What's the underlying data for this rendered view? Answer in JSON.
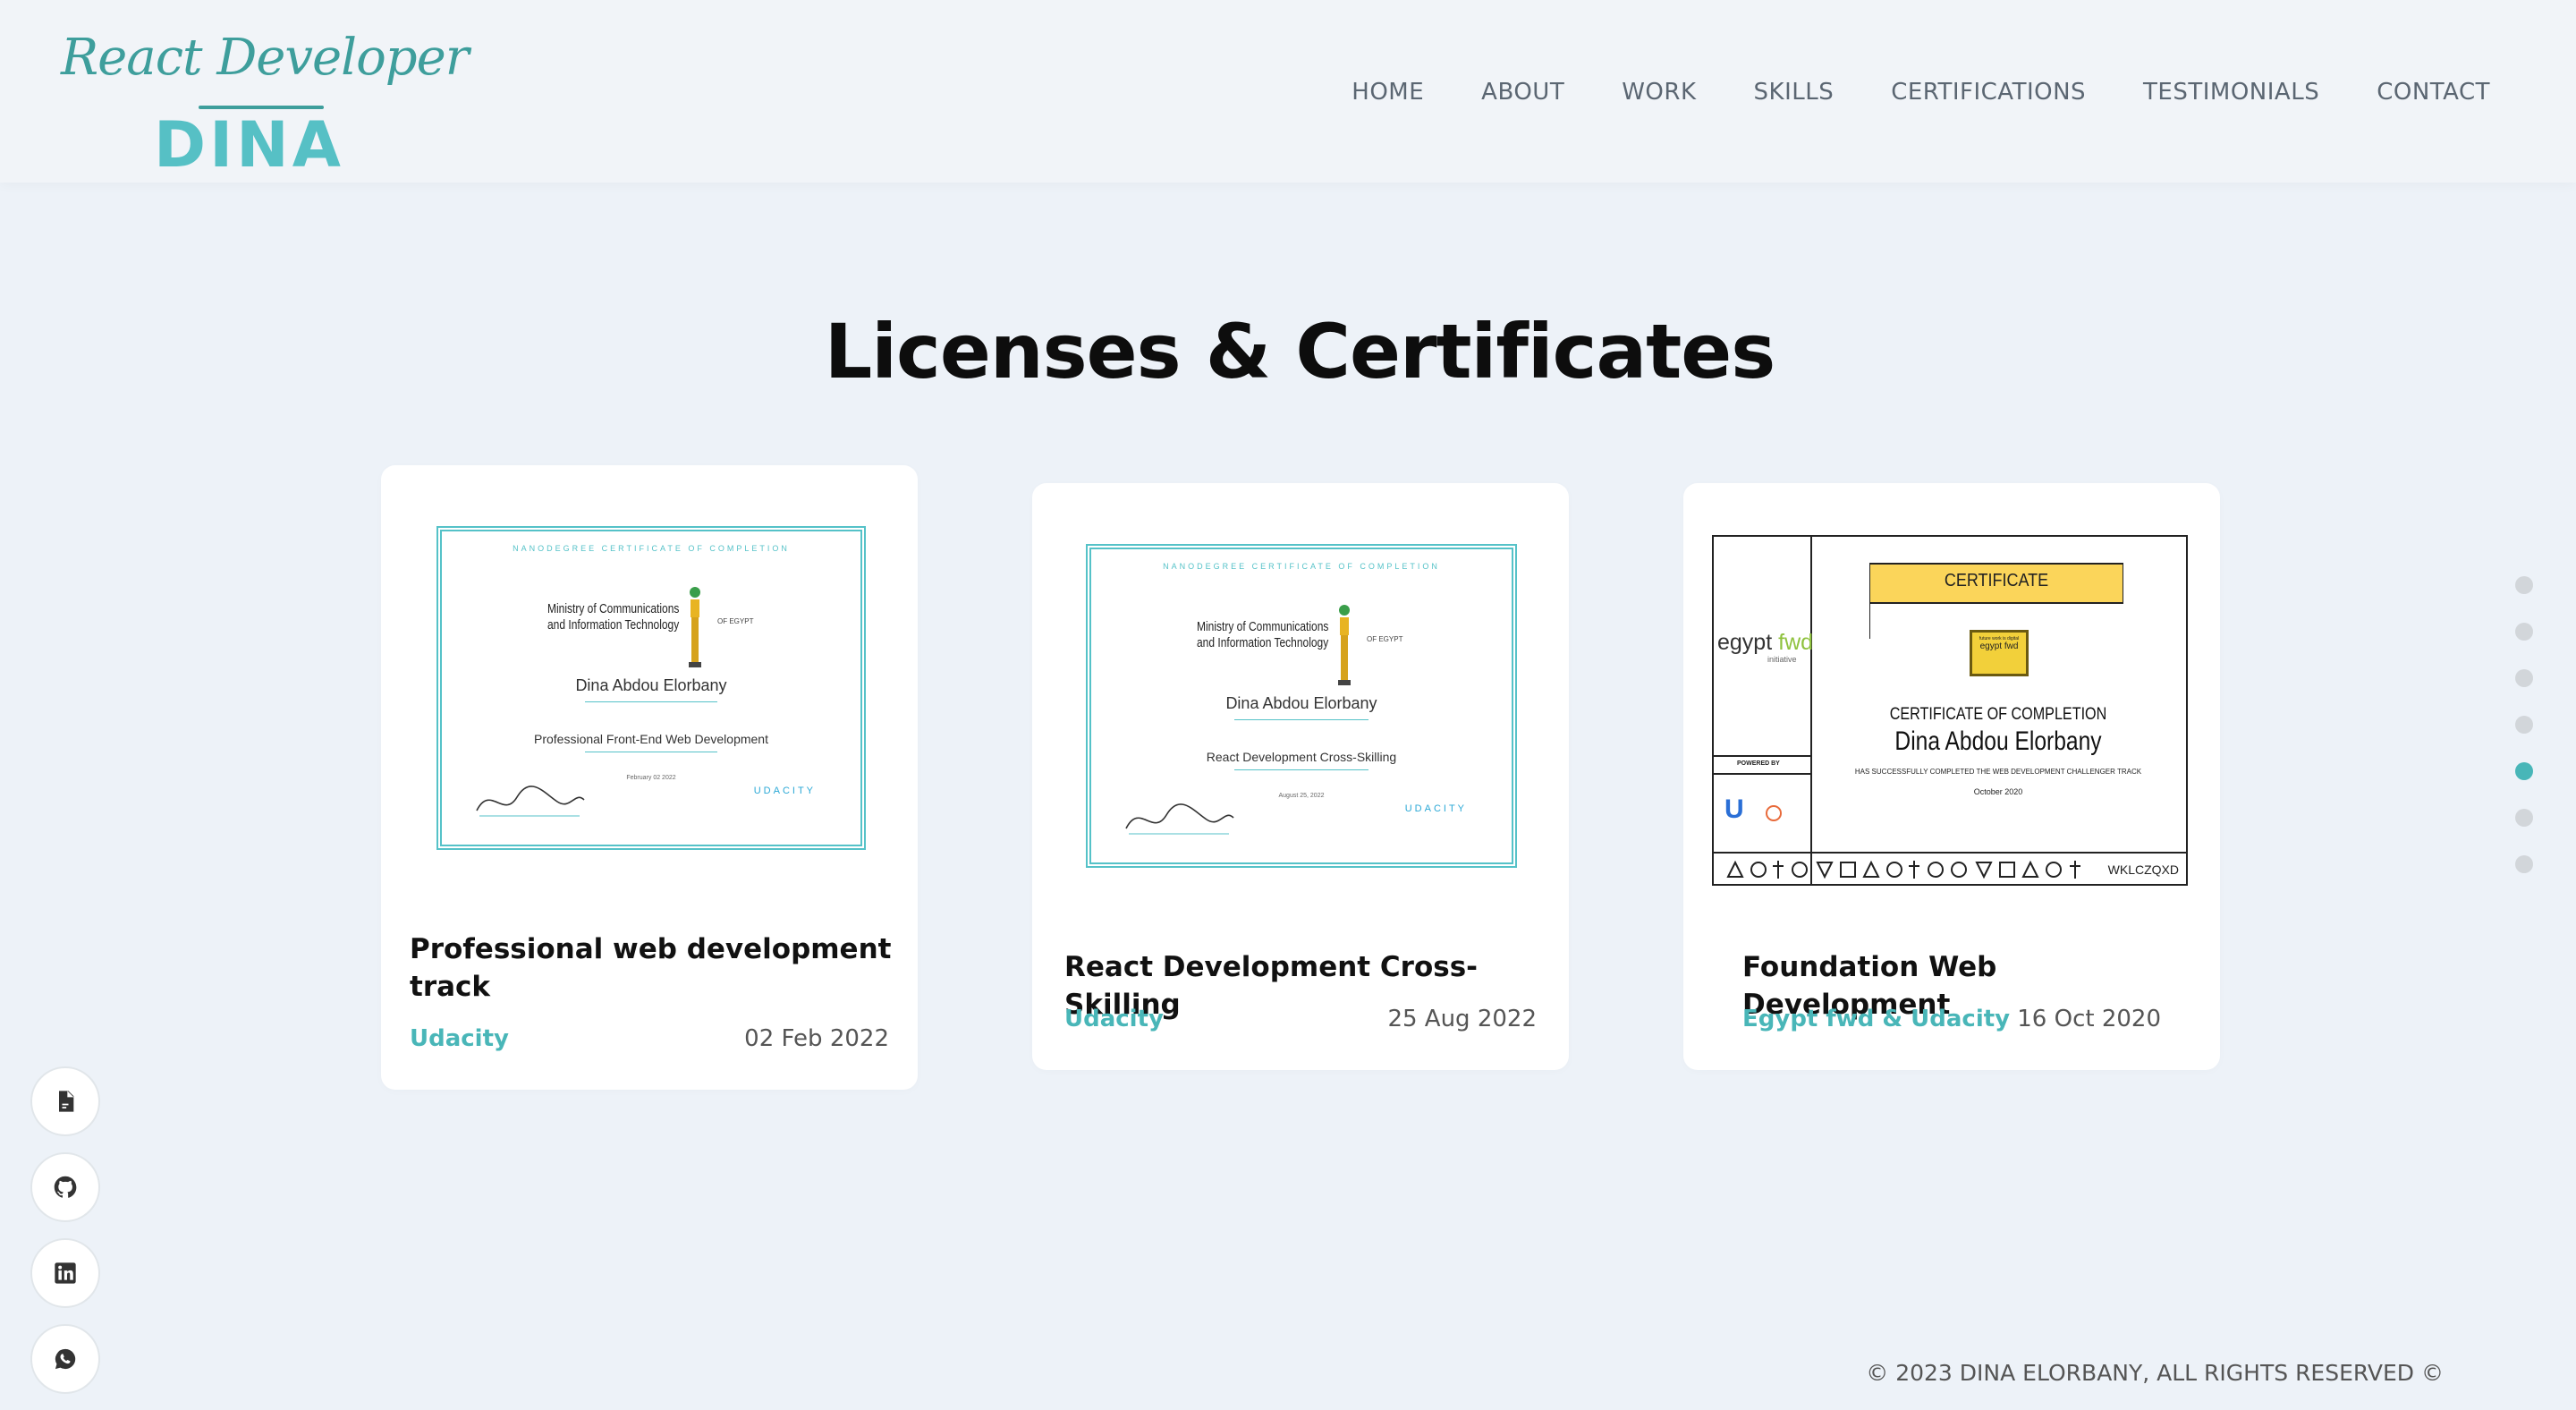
{
  "header": {
    "logo_script": "React Developer",
    "logo_name": "DINA",
    "nav": [
      "HOME",
      "ABOUT",
      "WORK",
      "SKILLS",
      "CERTIFICATIONS",
      "TESTIMONIALS",
      "CONTACT"
    ]
  },
  "page_title": "Licenses & Certificates",
  "cards": [
    {
      "title": "Professional web development track",
      "org": "Udacity",
      "date": "02 Feb 2022",
      "cert": {
        "header": "NANODEGREE CERTIFICATE OF COMPLETION",
        "ministry": "Ministry of Communications and Information Technology",
        "of": "OF EGYPT",
        "name": "Dina Abdou Elorbany",
        "course": "Professional Front-End Web Development",
        "date": "February 02 2022",
        "brand": "UDACITY"
      }
    },
    {
      "title": "React Development Cross-Skilling",
      "org": "Udacity",
      "date": "25 Aug 2022",
      "cert": {
        "header": "NANODEGREE CERTIFICATE OF COMPLETION",
        "ministry": "Ministry of Communications and Information Technology",
        "of": "OF EGYPT",
        "name": "Dina Abdou Elorbany",
        "course": "React Development Cross-Skilling",
        "date": "August 25, 2022",
        "brand": "UDACITY"
      }
    },
    {
      "title": "Foundation Web Development",
      "org": "Egypt fwd & Udacity",
      "date": "16 Oct 2020",
      "cert": {
        "ribbon": "CERTIFICATE",
        "brand_a": "egypt",
        "brand_b": "fwd",
        "brand_sub": "initiative",
        "powered": "POWERED BY",
        "completion": "CERTIFICATE OF COMPLETION",
        "name": "Dina Abdou Elorbany",
        "desc": "HAS SUCCESSFULLY COMPLETED THE WEB DEVELOPMENT CHALLENGER TRACK",
        "date": "October 2020",
        "code": "WKLCZQXD",
        "badge_top": "future work is digital",
        "badge_mid": "egypt fwd"
      }
    }
  ],
  "footer": "© 2023 DINA ELORBANY, ALL RIGHTS RESERVED ©",
  "colors": {
    "accent": "#48b6b8",
    "logo": "#3e9e9c",
    "background": "#edf2f8"
  }
}
